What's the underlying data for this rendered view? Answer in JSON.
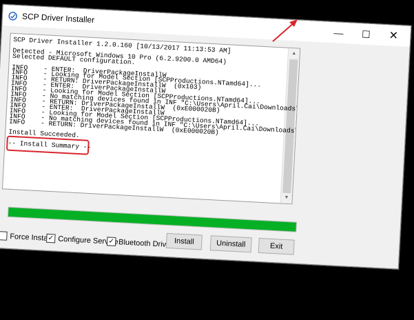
{
  "window": {
    "title": "SCP Driver Installer",
    "controls": {
      "minimize": "—",
      "maximize": "☐",
      "close": "✕"
    }
  },
  "log": {
    "lines": [
      "SCP Driver Installer 1.2.0.160 [10/13/2017 11:13:53 AM]",
      "",
      "Detected - Microsoft Windows 10 Pro (6.2.9200.0 AMD64)",
      "Selected DEFAULT configuration.",
      "",
      "INFO    - ENTER:  DriverPackageInstallW",
      "INFO    - Looking for Model Section [SCPProductions.NTamd64]...",
      "INFO    - RETURN: DriverPackageInstallW  (0x103)",
      "INFO    - ENTER:  DriverPackageInstallW",
      "INFO    - Looking for Model Section [SCPProductions.NTamd64]...",
      "INFO    - No matching devices found in INF \"C:\\Users\\April.Cai\\Downloads\\SCP-",
      "INFO    - RETURN: DriverPackageInstallW  (0xE000020B)",
      "INFO    - ENTER:  DriverPackageInstallW",
      "INFO    - Looking for Model Section [SCPProductions.NTamd64]...",
      "INFO    - No matching devices found in INF \"C:\\Users\\April.Cai\\Downloads\\SCP-",
      "INFO    - RETURN: DriverPackageInstallW  (0xE000020B)",
      "",
      "Install Succeeded.",
      "",
      "-- Install Summary --"
    ]
  },
  "progress": {
    "value": 1.0,
    "color": "#06b025"
  },
  "options": {
    "force_install": {
      "label": "Force Install",
      "checked": false
    },
    "configure_service": {
      "label": "Configure Service",
      "checked": true
    },
    "bluetooth_driver": {
      "label": "Bluetooth Driver",
      "checked": true
    }
  },
  "buttons": {
    "install": "Install",
    "uninstall": "Uninstall",
    "exit": "Exit"
  },
  "annotation": {
    "color": "#d8252d"
  }
}
